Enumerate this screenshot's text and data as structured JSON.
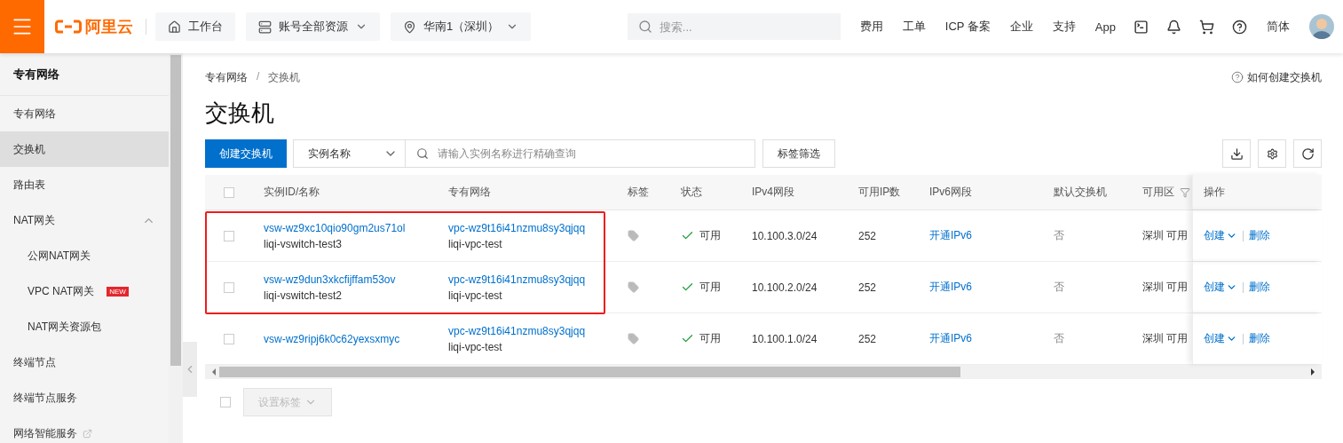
{
  "header": {
    "brand": "阿里云",
    "nav": [
      {
        "kind": "home",
        "label": "工作台",
        "dropdown": false
      },
      {
        "kind": "resources",
        "label": "账号全部资源",
        "dropdown": true
      },
      {
        "kind": "region",
        "label": "华南1（深圳）",
        "dropdown": true
      }
    ],
    "search": {
      "placeholder": "搜索..."
    },
    "links": [
      "费用",
      "工单",
      "ICP 备案",
      "企业",
      "支持",
      "App"
    ],
    "language": "简体"
  },
  "sidebar": {
    "title": "专有网络",
    "items": [
      {
        "label": "专有网络",
        "selected": false
      },
      {
        "label": "交换机",
        "selected": true
      },
      {
        "label": "路由表",
        "selected": false
      },
      {
        "label": "NAT网关",
        "selected": false,
        "expanded": true,
        "children": [
          {
            "label": "公网NAT网关",
            "selected": false
          },
          {
            "label": "VPC NAT网关",
            "selected": false,
            "badge": "NEW"
          },
          {
            "label": "NAT网关资源包",
            "selected": false
          }
        ]
      },
      {
        "label": "终端节点",
        "selected": false
      },
      {
        "label": "终端节点服务",
        "selected": false
      },
      {
        "label": "网络智能服务",
        "selected": false,
        "external": true
      }
    ]
  },
  "page": {
    "breadcrumb": [
      "专有网络",
      "交换机"
    ],
    "breadcrumb_separator": "/",
    "help_link": "如何创建交换机",
    "title": "交换机",
    "toolbar": {
      "create_button": "创建交换机",
      "filter_select": "实例名称",
      "search": {
        "placeholder": "请输入实例名称进行精确查询"
      },
      "tag_filter": "标签筛选"
    },
    "table": {
      "select_all_checked": false,
      "columns": [
        "实例ID/名称",
        "专有网络",
        "标签",
        "状态",
        "IPv4网段",
        "可用IP数",
        "IPv6网段",
        "默认交换机",
        "可用区",
        "操作"
      ],
      "rows": [
        {
          "checked": false,
          "highlighted": true,
          "id": "vsw-wz9xc10qio90gm2us71ol",
          "name": "liqi-vswitch-test3",
          "vpc_id": "vpc-wz9t16i41nzmu8sy3qjqq",
          "vpc_name": "liqi-vpc-test",
          "status": "可用",
          "ipv4": "10.100.3.0/24",
          "ip_count": "252",
          "ipv6": "开通IPv6",
          "default": "否",
          "zone": "深圳 可用",
          "actions": [
            "创建",
            "删除"
          ]
        },
        {
          "checked": false,
          "highlighted": true,
          "id": "vsw-wz9dun3xkcfijffam53ov",
          "name": "liqi-vswitch-test2",
          "vpc_id": "vpc-wz9t16i41nzmu8sy3qjqq",
          "vpc_name": "liqi-vpc-test",
          "status": "可用",
          "ipv4": "10.100.2.0/24",
          "ip_count": "252",
          "ipv6": "开通IPv6",
          "default": "否",
          "zone": "深圳 可用",
          "actions": [
            "创建",
            "删除"
          ]
        },
        {
          "checked": false,
          "highlighted": false,
          "id": "vsw-wz9ripj6k0c62yexsxmyc",
          "vpc_id": "vpc-wz9t16i41nzmu8sy3qjqq",
          "vpc_name": "liqi-vpc-test",
          "status": "可用",
          "ipv4": "10.100.1.0/24",
          "ip_count": "252",
          "ipv6": "开通IPv6",
          "default": "否",
          "zone": "深圳 可用",
          "actions": [
            "创建",
            "删除"
          ]
        }
      ]
    },
    "footer": {
      "select_all_checked": false,
      "set_tags_button": {
        "label": "设置标签",
        "disabled": true
      }
    }
  }
}
